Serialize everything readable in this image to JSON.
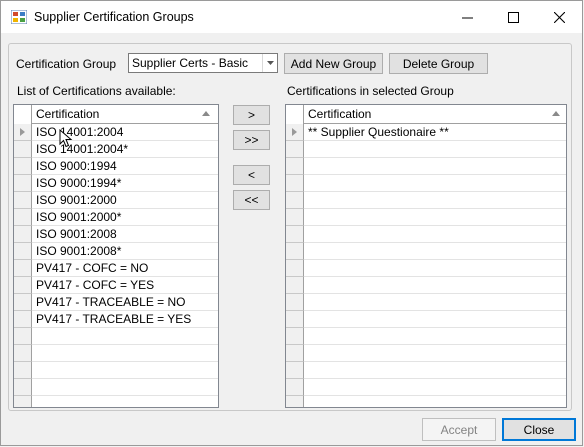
{
  "window": {
    "title": "Supplier Certification Groups"
  },
  "group": {
    "label": "Certification Group",
    "selected_value": "Supplier Certs - Basic",
    "add_label": "Add New Group",
    "delete_label": "Delete Group"
  },
  "available": {
    "heading": "List of Certifications available:",
    "column": "Certification",
    "rows": [
      "ISO 14001:2004",
      "ISO 14001:2004*",
      "ISO 9000:1994",
      "ISO 9000:1994*",
      "ISO 9001:2000",
      "ISO 9001:2000*",
      "ISO 9001:2008",
      "ISO 9001:2008*",
      "PV417 - COFC = NO",
      "PV417 - COFC = YES",
      "PV417 - TRACEABLE = NO",
      "PV417 - TRACEABLE = YES"
    ]
  },
  "selected": {
    "heading": "Certifications in selected Group",
    "column": "Certification",
    "rows": [
      "** Supplier Questionaire **"
    ]
  },
  "transfer": {
    "add_one": ">",
    "add_all": ">>",
    "remove_one": "<",
    "remove_all": "<<"
  },
  "footer": {
    "accept_label": "Accept",
    "close_label": "Close"
  },
  "colors": {
    "accent": "#0078d7",
    "window_bg": "#f0f0f0",
    "grid_border": "#828790"
  }
}
